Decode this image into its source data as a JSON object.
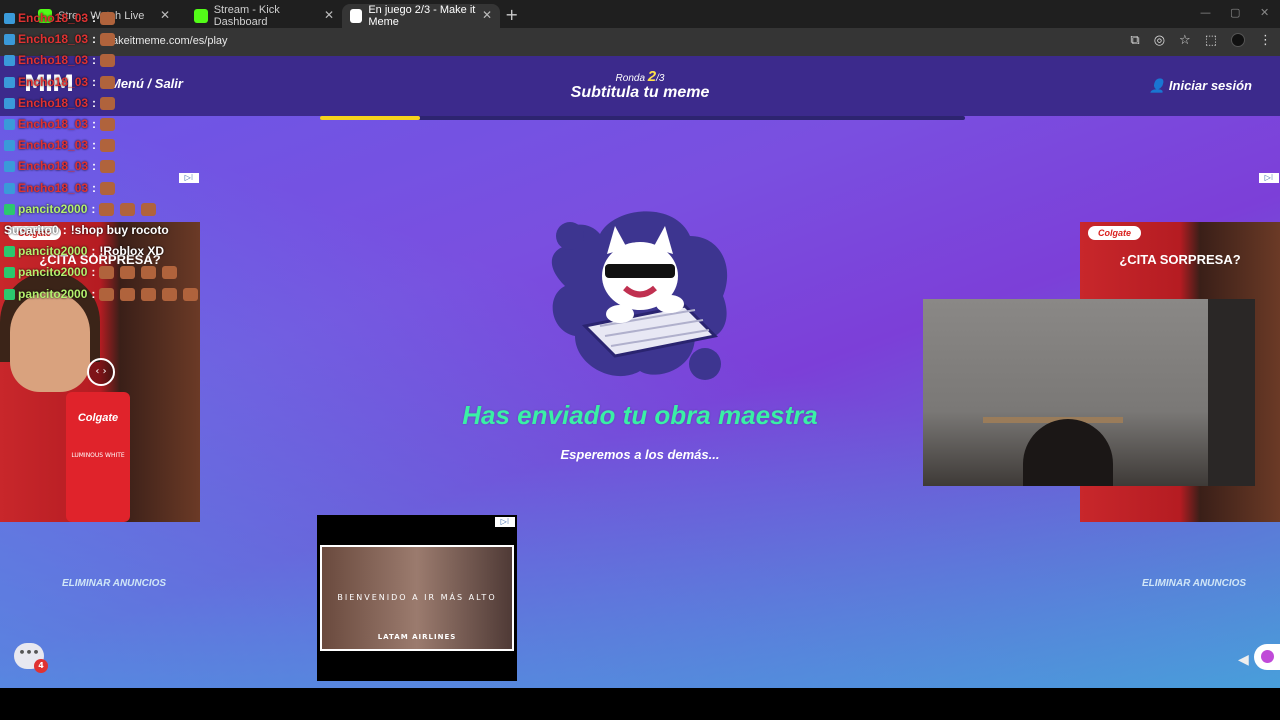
{
  "browser": {
    "tabs": [
      {
        "label": "Stre... Watch Live",
        "active": false,
        "icon_color": "#53fc18"
      },
      {
        "label": "Stream - Kick Dashboard",
        "active": false,
        "icon_color": "#53fc18"
      },
      {
        "label": "En juego 2/3 - Make it Meme",
        "active": true,
        "icon_color": "#ffffff"
      }
    ],
    "url": "akeitmeme.com/es/play"
  },
  "header": {
    "logo": "MIM",
    "menu": "Menú / Salir",
    "round_label": "Ronda",
    "round_current": "2",
    "round_total": "/3",
    "title": "Subtitula tu meme",
    "login": "Iniciar sesión",
    "progress_fraction": 0.155
  },
  "main": {
    "sent": "Has enviado tu obra maestra",
    "wait": "Esperemos a los demás..."
  },
  "ads": {
    "brand": "Colgate",
    "title": "¿CITA SORPRESA?",
    "tube_label": "Colgate",
    "tube_sub": "LUMINOUS WHITE",
    "remove_ads": "ELIMINAR ANUNCIOS",
    "bottom_text": "BIENVENIDO A IR MÁS ALTO",
    "bottom_brand": "LATAM AIRLINES"
  },
  "chat": {
    "messages": [
      {
        "user": "Encho18_03",
        "text": ""
      },
      {
        "user": "Encho18_03",
        "text": ""
      },
      {
        "user": "Encho18_03",
        "text": ""
      },
      {
        "user": "Encho18_03",
        "text": ""
      },
      {
        "user": "Encho18_03",
        "text": ""
      },
      {
        "user": "Encho18_03",
        "text": ""
      },
      {
        "user": "Encho18_03",
        "text": ""
      },
      {
        "user": "Encho18_03",
        "text": ""
      },
      {
        "user": "Encho18_03",
        "text": ""
      },
      {
        "user": "pancito2000",
        "text": ""
      },
      {
        "user": "Sucarito0",
        "text": "!shop buy rocoto"
      },
      {
        "user": "pancito2000",
        "text": "!Roblox XD"
      },
      {
        "user": "pancito2000",
        "text": ""
      },
      {
        "user": "pancito2000",
        "text": ""
      }
    ]
  },
  "corner": {
    "chat_count": "4"
  }
}
